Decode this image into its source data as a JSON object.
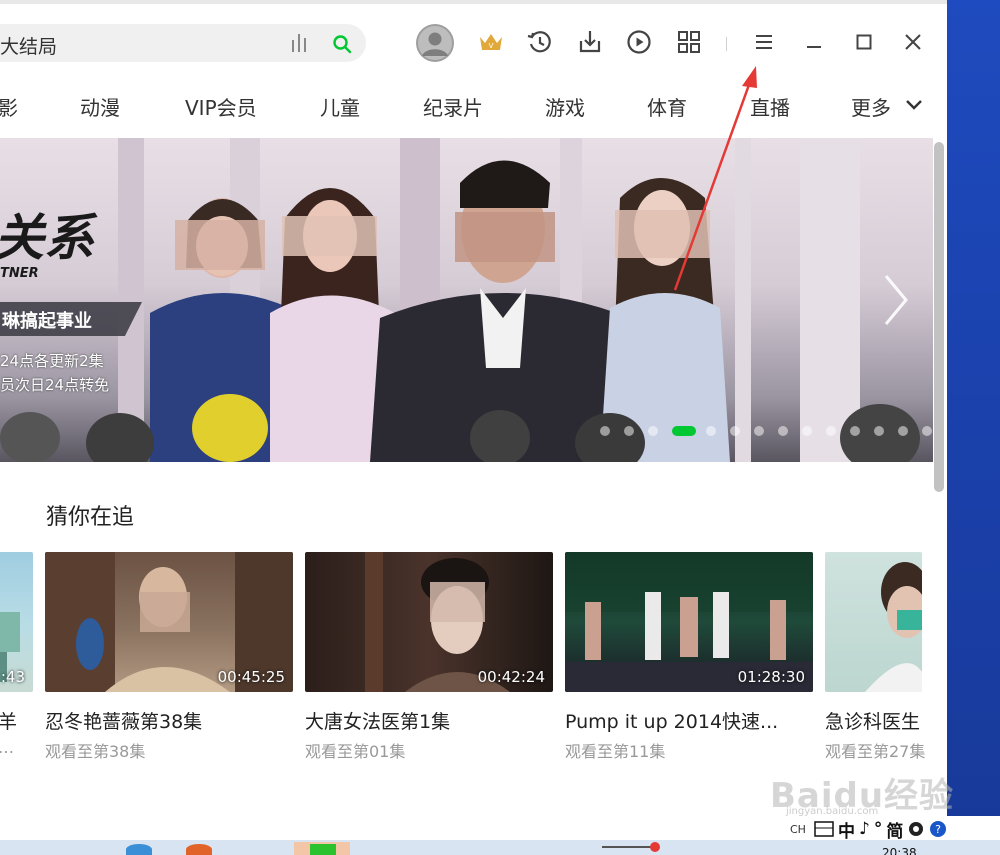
{
  "search": {
    "query": "大结局"
  },
  "nav": {
    "items": [
      "影",
      "动漫",
      "VIP会员",
      "儿童",
      "纪录片",
      "游戏",
      "体育",
      "直播",
      "更多"
    ]
  },
  "banner": {
    "title": "关系",
    "subtitle": "TNER",
    "tag": "琳搞起事业",
    "line1": "24点各更新2集",
    "line2": "员次日24点转免",
    "dot_count": 14,
    "active_dot_index": 3
  },
  "section": {
    "title": "猜你在追"
  },
  "cards": [
    {
      "title": "羊",
      "sub": "…",
      "duration": ":43"
    },
    {
      "title": "忍冬艳蔷薇第38集",
      "sub": "观看至第38集",
      "duration": "00:45:25"
    },
    {
      "title": "大唐女法医第1集",
      "sub": "观看至第01集",
      "duration": "00:42:24"
    },
    {
      "title": "Pump it up 2014快速...",
      "sub": "观看至第11集",
      "duration": "01:28:30"
    },
    {
      "title": "急诊科医生",
      "sub": "观看至第27集",
      "duration": ""
    }
  ],
  "tray": {
    "items": [
      "中",
      "♪",
      "°",
      "简"
    ],
    "lang": "CH"
  },
  "watermark": {
    "text": "Baidu经验",
    "sub": "jingyan.baidu.com"
  },
  "clock": {
    "time": "20:38"
  },
  "colors": {
    "accent_green": "#00c832",
    "annotation_red": "#e53935"
  }
}
